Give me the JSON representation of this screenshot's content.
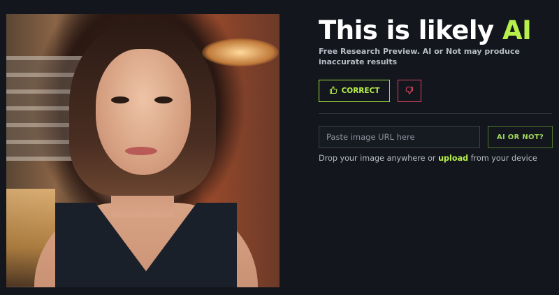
{
  "result": {
    "title_prefix": "This is likely",
    "title_verdict": "AI",
    "disclaimer": "Free Research Preview. AI or Not may produce inaccurate results"
  },
  "feedback": {
    "correct_label": "CORRECT",
    "correct_icon": "thumbs-up-icon",
    "incorrect_icon": "thumbs-down-icon"
  },
  "checker": {
    "url_placeholder": "Paste image URL here",
    "url_value": "",
    "submit_label": "AI OR NOT?",
    "drop_prefix": "Drop your image anywhere or",
    "upload_link": "upload",
    "drop_suffix": "from your device"
  },
  "colors": {
    "background": "#13161d",
    "accent_green": "#b7f04a",
    "danger_red": "#d6455f"
  }
}
